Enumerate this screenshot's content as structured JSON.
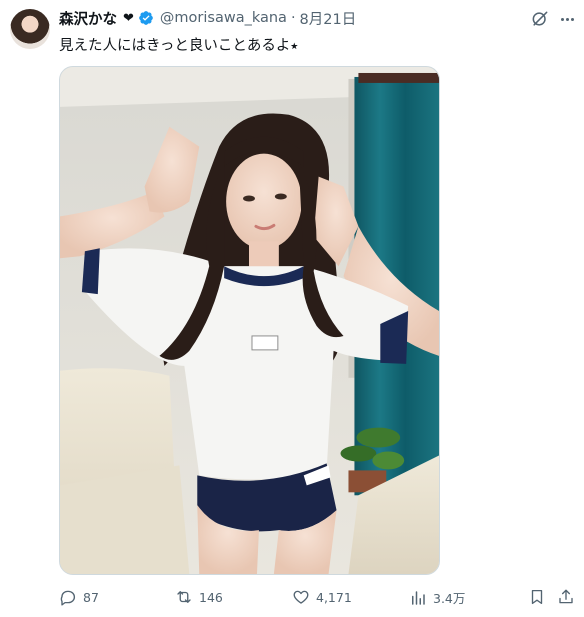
{
  "tweet": {
    "display_name": "森沢かな",
    "name_emoji": "❤",
    "handle": "@morisawa_kana",
    "separator": "·",
    "date": "8月21日",
    "text": "見えた人にはきっと良いことあるよ⭑",
    "stats": {
      "replies": "87",
      "reposts": "146",
      "likes": "4,171",
      "views": "3.4万"
    }
  },
  "icons": {
    "verified": "verified-badge-icon",
    "grok": "grok-icon",
    "more": "more-icon",
    "reply": "reply-icon",
    "repost": "repost-icon",
    "like": "heart-icon",
    "views": "analytics-icon",
    "bookmark": "bookmark-icon",
    "share": "share-icon"
  },
  "colors": {
    "text": "#0f1419",
    "secondary": "#536471",
    "verified": "#1d9bf0",
    "border": "#cfd9de"
  }
}
